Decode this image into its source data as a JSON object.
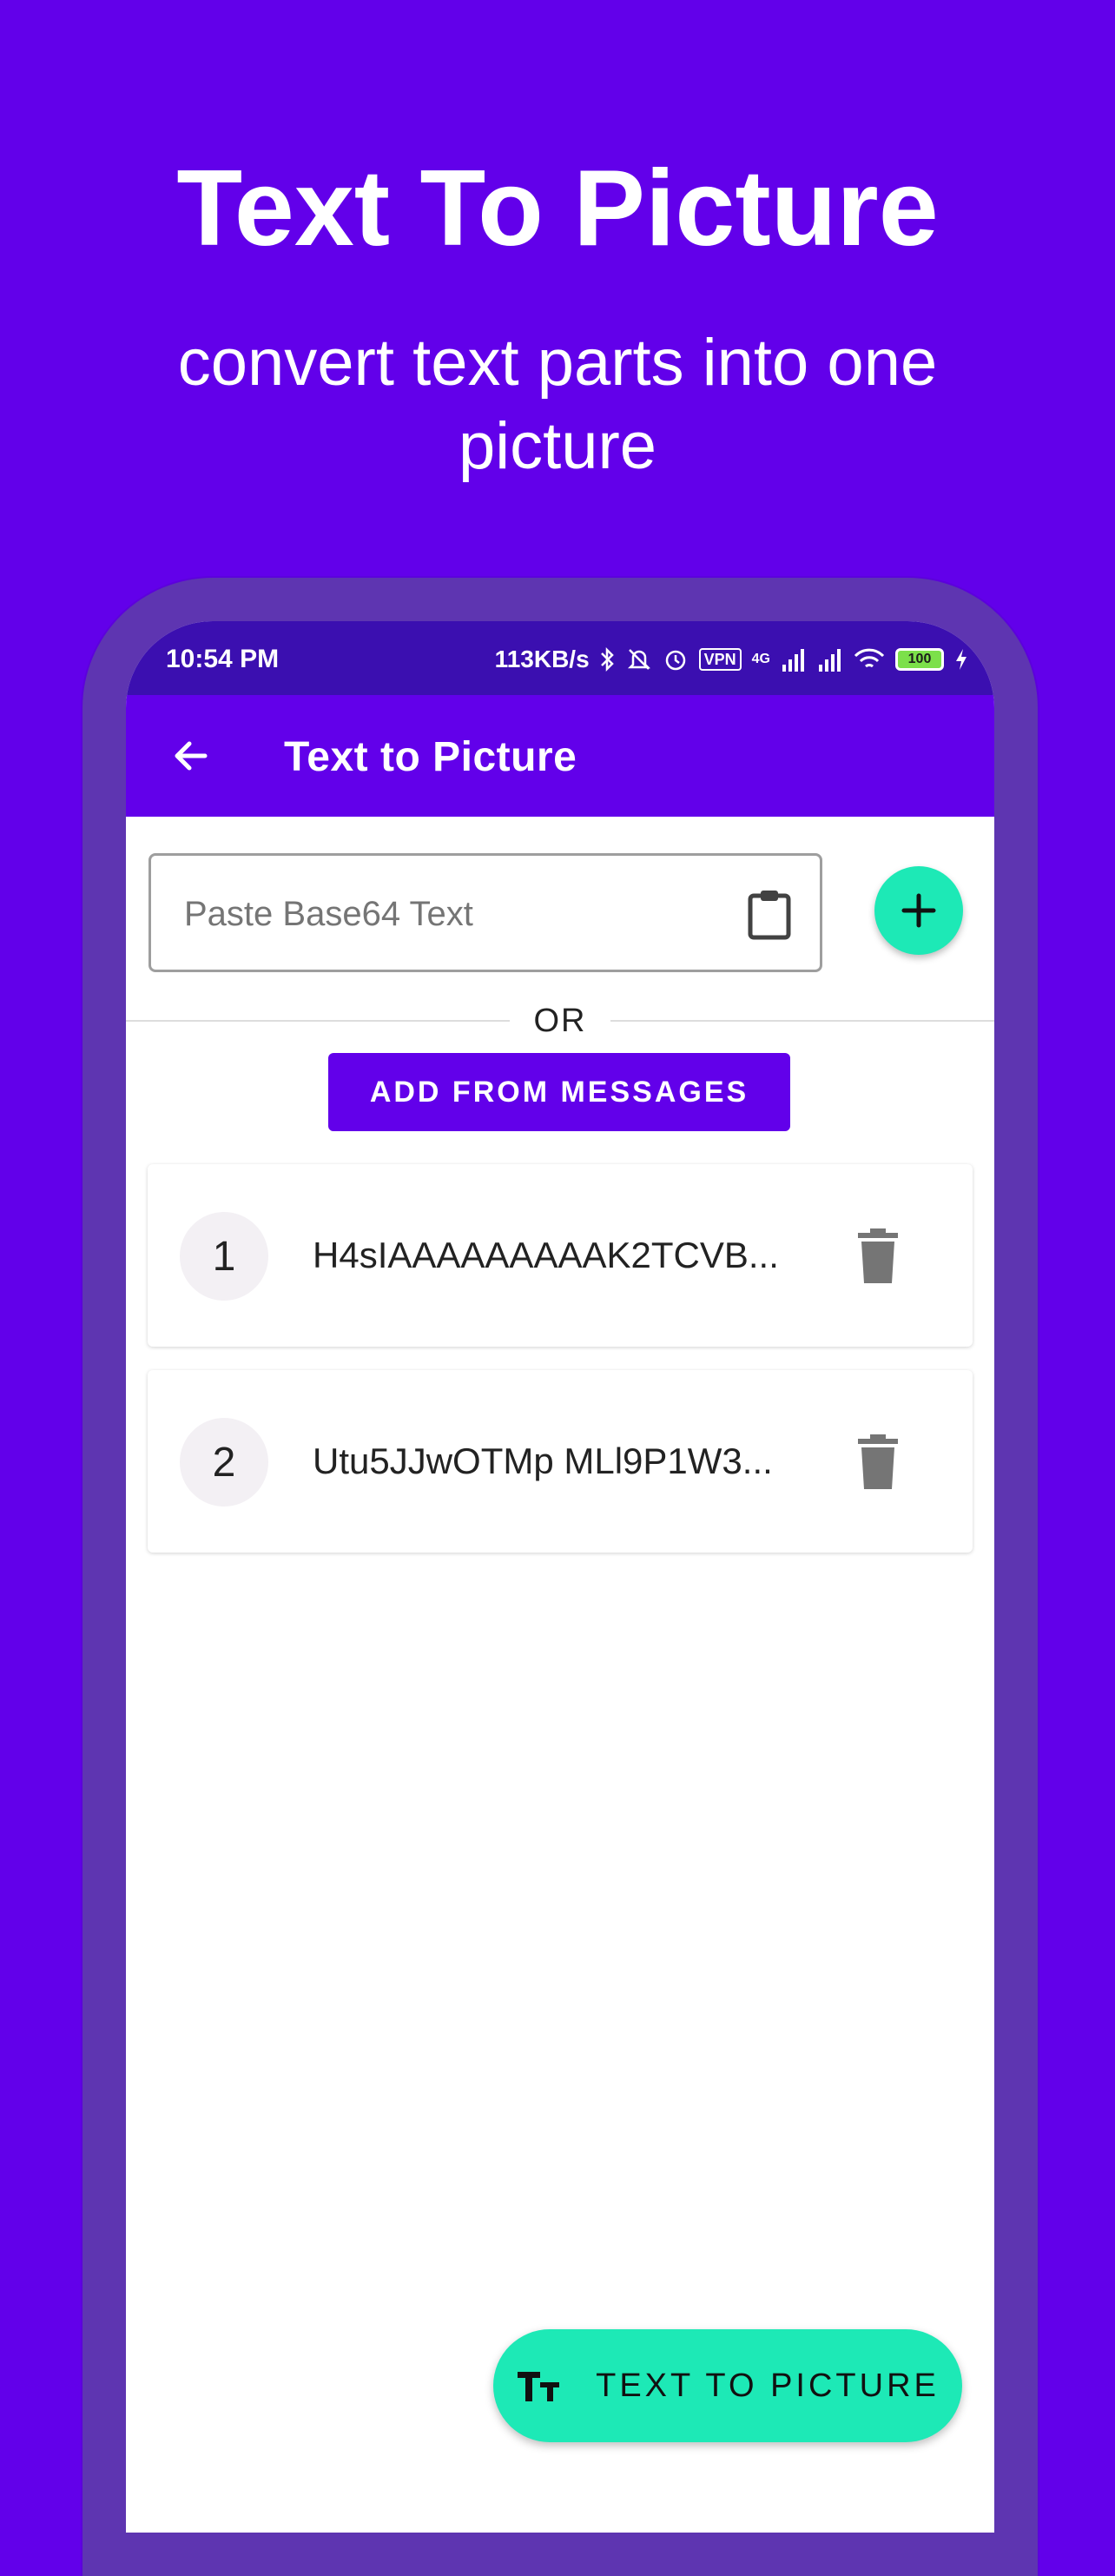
{
  "promo": {
    "title": "Text To Picture",
    "subtitle": "convert text parts into one picture"
  },
  "status_bar": {
    "time": "10:54 PM",
    "network_speed": "113KB/s",
    "vpn_label": "VPN",
    "signal_label": "4G",
    "battery_level": "100"
  },
  "app_bar": {
    "title": "Text to Picture",
    "back_icon": "arrow-left-icon"
  },
  "input": {
    "placeholder": "Paste Base64 Text",
    "value": "",
    "paste_icon": "clipboard-icon"
  },
  "add_button_icon": "plus-icon",
  "divider_text": "OR",
  "messages_button_label": "ADD FROM MESSAGES",
  "items": [
    {
      "number": "1",
      "text": "H4sIAAAAAAAAAK2TCVB..."
    },
    {
      "number": "2",
      "text": "Utu5JJwOTMp MLl9P1W3..."
    }
  ],
  "convert_button": {
    "label": "TEXT TO PICTURE",
    "icon": "text-size-icon"
  },
  "colors": {
    "primary": "#6200ea",
    "accent": "#1de9b6",
    "frame": "#5e35b1"
  }
}
